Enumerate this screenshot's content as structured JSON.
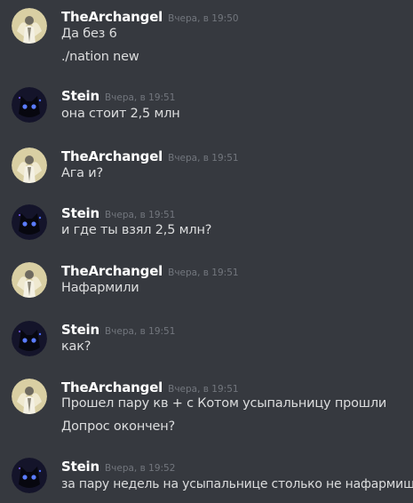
{
  "messages": [
    {
      "author": "TheArchangel",
      "time": "Вчера, в 19:50",
      "lines": [
        "Да без 6",
        "./nation new"
      ]
    },
    {
      "author": "Stein",
      "time": "Вчера, в 19:51",
      "lines": [
        "она стоит 2,5 млн"
      ]
    },
    {
      "author": "TheArchangel",
      "time": "Вчера, в 19:51",
      "lines": [
        "Ага и?"
      ]
    },
    {
      "author": "Stein",
      "time": "Вчера, в 19:51",
      "lines": [
        "и где ты взял 2,5 млн?"
      ]
    },
    {
      "author": "TheArchangel",
      "time": "Вчера, в 19:51",
      "lines": [
        "Нафармили"
      ]
    },
    {
      "author": "Stein",
      "time": "Вчера, в 19:51",
      "lines": [
        "как?"
      ]
    },
    {
      "author": "TheArchangel",
      "time": "Вчера, в 19:51",
      "lines": [
        "Прошел пару кв + с Котом усыпальницу прошли",
        "Допрос окончен?"
      ]
    },
    {
      "author": "Stein",
      "time": "Вчера, в 19:52",
      "lines": [
        "за пару недель на усыпальнице столько не нафармишь"
      ]
    }
  ],
  "colors": {
    "background": "#36393f",
    "username": "#ffffff",
    "timestamp": "#72767d",
    "text": "#dcddde"
  },
  "icons": {
    "archangel_avatar": "angel-avatar-icon",
    "stein_avatar": "dark-cat-avatar-icon"
  }
}
